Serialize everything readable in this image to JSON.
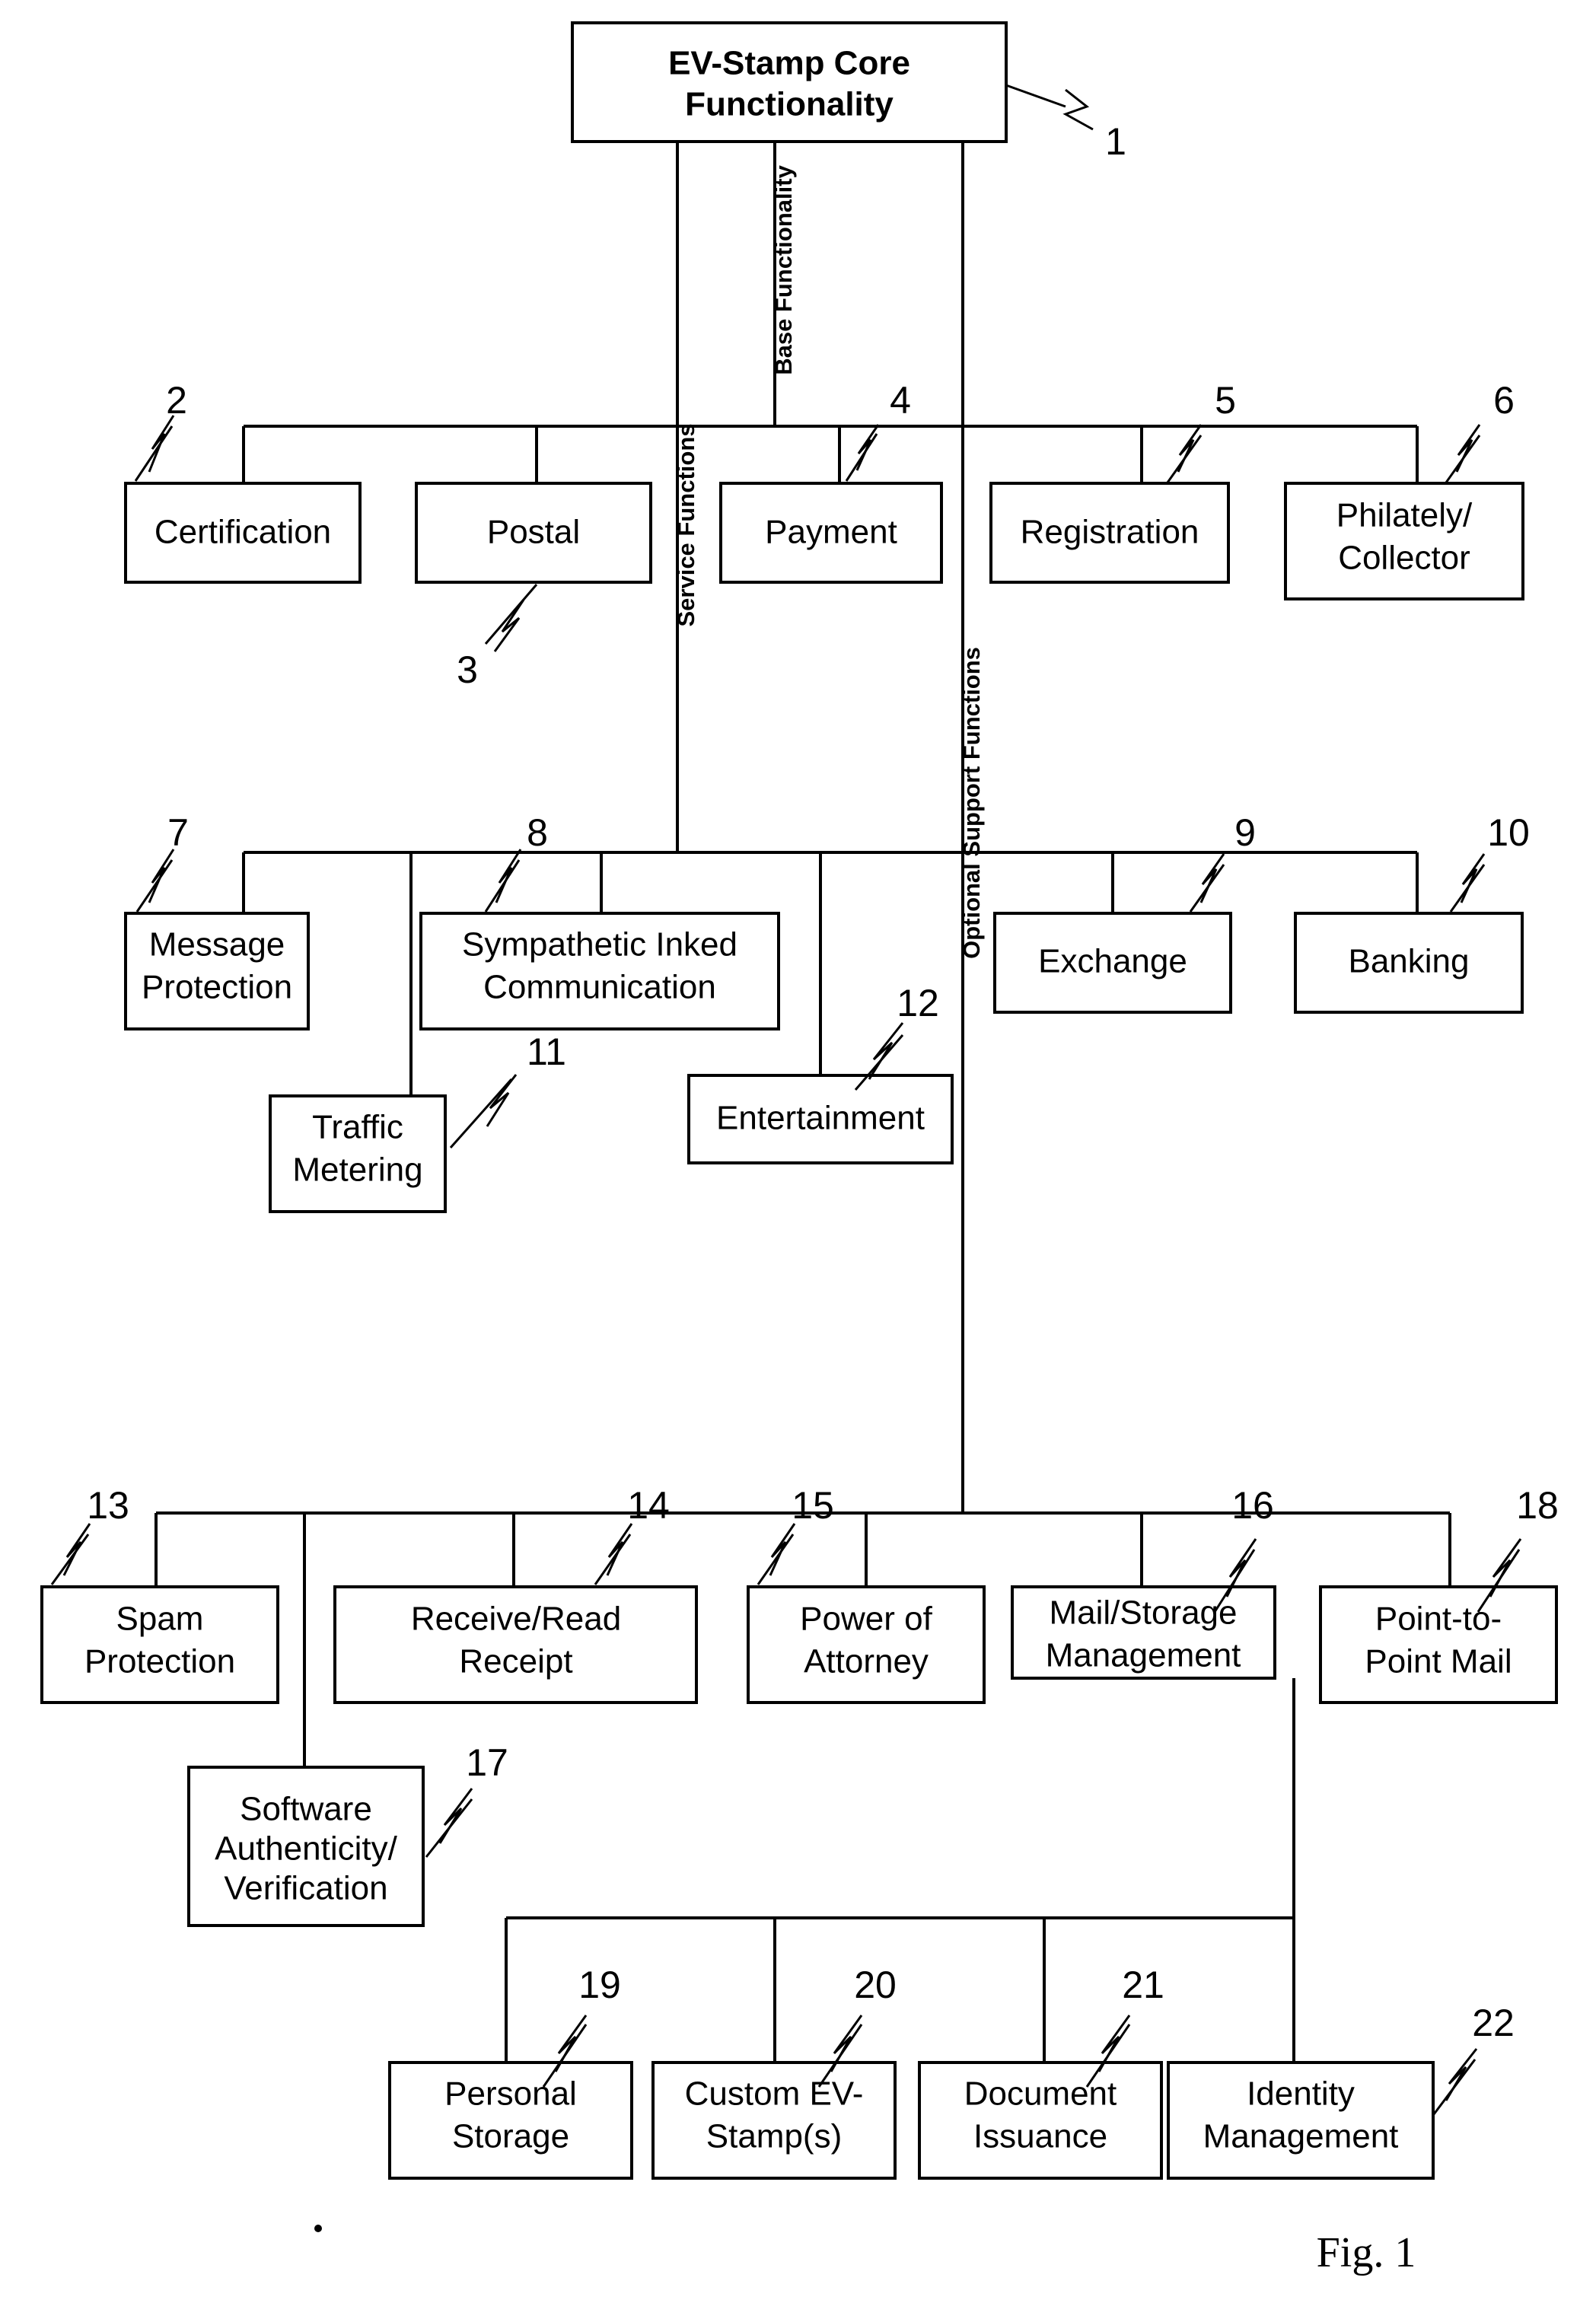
{
  "figure": {
    "caption": "Fig. 1",
    "root": {
      "id": "1",
      "label_line1": "EV-Stamp Core",
      "label_line2": "Functionality",
      "ref": "1"
    },
    "bus_labels": {
      "base_functionality": "Base Functionality",
      "service_functions": "Service Functions",
      "optional_support_functions": "Optional Support Functions"
    },
    "groups": [
      {
        "name": "service-functions-row-1",
        "nodes": [
          {
            "ref": "2",
            "lines": [
              "Certification"
            ]
          },
          {
            "ref": "3",
            "lines": [
              "Postal"
            ]
          },
          {
            "ref": "4",
            "lines": [
              "Payment"
            ]
          },
          {
            "ref": "5",
            "lines": [
              "Registration"
            ]
          },
          {
            "ref": "6",
            "lines": [
              "Philately/",
              "Collector"
            ]
          }
        ]
      },
      {
        "name": "service-functions-row-2",
        "nodes": [
          {
            "ref": "7",
            "lines": [
              "Message",
              "Protection"
            ]
          },
          {
            "ref": "8",
            "lines": [
              "Sympathetic Inked",
              "Communication"
            ]
          },
          {
            "ref": "9",
            "lines": [
              "Exchange"
            ]
          },
          {
            "ref": "10",
            "lines": [
              "Banking"
            ]
          },
          {
            "ref": "11",
            "lines": [
              "Traffic",
              "Metering"
            ]
          },
          {
            "ref": "12",
            "lines": [
              "Entertainment"
            ]
          }
        ]
      },
      {
        "name": "optional-support-row-1",
        "nodes": [
          {
            "ref": "13",
            "lines": [
              "Spam",
              "Protection"
            ]
          },
          {
            "ref": "14",
            "lines": [
              "Receive/Read",
              "Receipt"
            ]
          },
          {
            "ref": "15",
            "lines": [
              "Power of",
              "Attorney"
            ]
          },
          {
            "ref": "16",
            "lines": [
              "Mail/Storage",
              "Management"
            ]
          },
          {
            "ref": "18",
            "lines": [
              "Point-to-",
              "Point Mail"
            ]
          },
          {
            "ref": "17",
            "lines": [
              "Software",
              "Authenticity/",
              "Verification"
            ]
          }
        ]
      },
      {
        "name": "optional-support-row-2",
        "nodes": [
          {
            "ref": "19",
            "lines": [
              "Personal",
              "Storage"
            ]
          },
          {
            "ref": "20",
            "lines": [
              "Custom EV-",
              "Stamp(s)"
            ]
          },
          {
            "ref": "21",
            "lines": [
              "Document",
              "Issuance"
            ]
          },
          {
            "ref": "22",
            "lines": [
              "Identity",
              "Management"
            ]
          }
        ]
      }
    ],
    "nodes_flat": {
      "n1_l1": "EV-Stamp Core",
      "n1_l2": "Functionality",
      "n2": "Certification",
      "n3": "Postal",
      "n4": "Payment",
      "n5": "Registration",
      "n6_l1": "Philately/",
      "n6_l2": "Collector",
      "n7_l1": "Message",
      "n7_l2": "Protection",
      "n8_l1": "Sympathetic Inked",
      "n8_l2": "Communication",
      "n9": "Exchange",
      "n10": "Banking",
      "n11_l1": "Traffic",
      "n11_l2": "Metering",
      "n12": "Entertainment",
      "n13_l1": "Spam",
      "n13_l2": "Protection",
      "n14_l1": "Receive/Read",
      "n14_l2": "Receipt",
      "n15_l1": "Power of",
      "n15_l2": "Attorney",
      "n16_l1": "Mail/Storage",
      "n16_l2": "Management",
      "n17_l1": "Software",
      "n17_l2": "Authenticity/",
      "n17_l3": "Verification",
      "n18_l1": "Point-to-",
      "n18_l2": "Point Mail",
      "n19_l1": "Personal",
      "n19_l2": "Storage",
      "n20_l1": "Custom EV-",
      "n20_l2": "Stamp(s)",
      "n21_l1": "Document",
      "n21_l2": "Issuance",
      "n22_l1": "Identity",
      "n22_l2": "Management"
    },
    "refs": {
      "r1": "1",
      "r2": "2",
      "r3": "3",
      "r4": "4",
      "r5": "5",
      "r6": "6",
      "r7": "7",
      "r8": "8",
      "r9": "9",
      "r10": "10",
      "r11": "11",
      "r12": "12",
      "r13": "13",
      "r14": "14",
      "r15": "15",
      "r16": "16",
      "r17": "17",
      "r18": "18",
      "r19": "19",
      "r20": "20",
      "r21": "21",
      "r22": "22"
    },
    "colors": {
      "stroke": "#000000",
      "fill": "#ffffff"
    }
  }
}
